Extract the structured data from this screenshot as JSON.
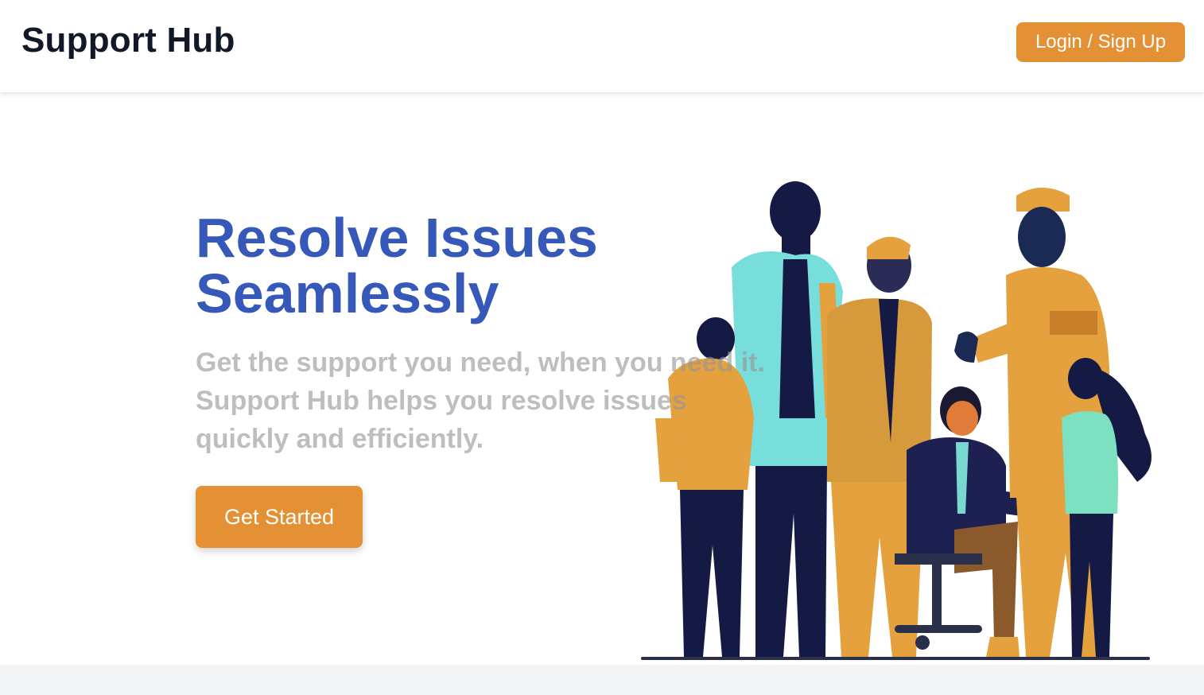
{
  "header": {
    "brand": "Support Hub",
    "login_label": "Login / Sign Up"
  },
  "hero": {
    "title_line1": "Resolve Issues",
    "title_line2": "Seamlessly",
    "subtitle_line1": "Get the support you need, when you need it.",
    "subtitle_line2": "Support Hub helps you resolve issues",
    "subtitle_line3": "quickly and efficiently.",
    "cta_label": "Get Started"
  },
  "colors": {
    "accent": "#e49034",
    "title": "#3658b8",
    "brand_text": "#111827",
    "subtitle": "#a0a0a0",
    "footer_bg": "#f3f4f6"
  },
  "illustration": {
    "icon": "team-people-illustration"
  }
}
